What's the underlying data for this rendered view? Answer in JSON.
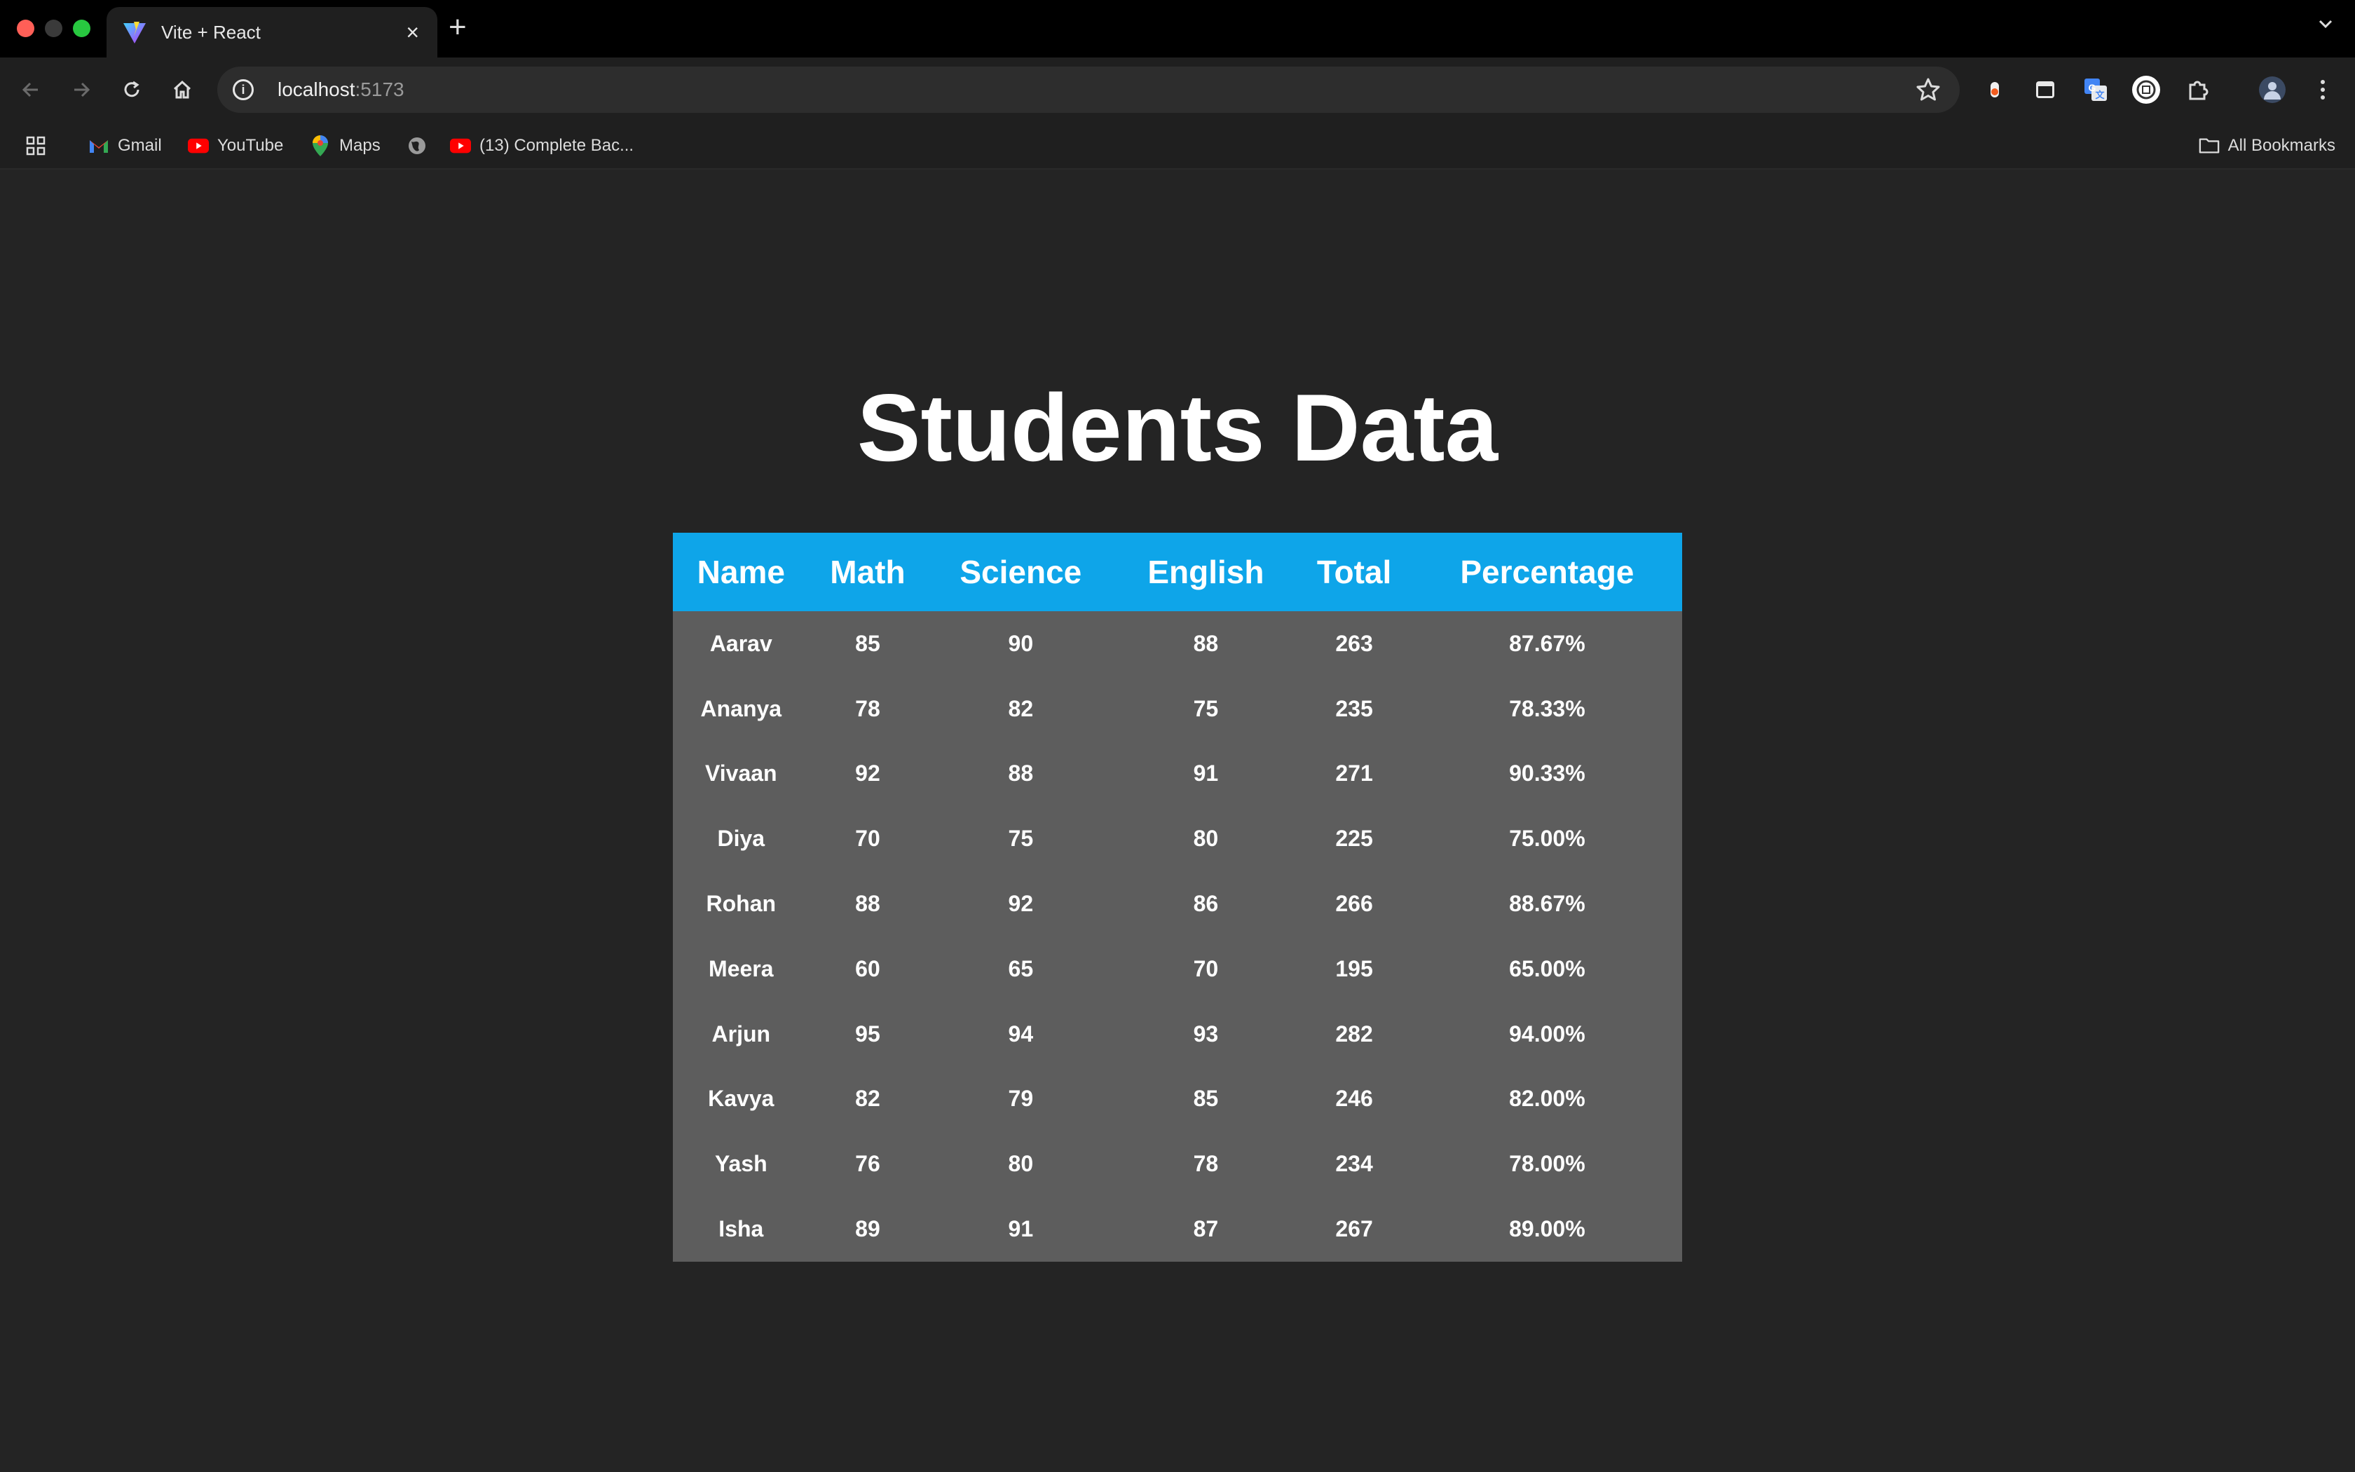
{
  "browser": {
    "tab_title": "Vite + React",
    "tab_close": "×",
    "new_tab": "+",
    "url_host": "localhost",
    "url_port": ":5173",
    "bookmarks": [
      {
        "label": "Gmail",
        "icon": "gmail-icon"
      },
      {
        "label": "YouTube",
        "icon": "youtube-icon"
      },
      {
        "label": "Maps",
        "icon": "maps-icon"
      },
      {
        "label": "",
        "icon": "globe-icon"
      },
      {
        "label": "(13) Complete Bac...",
        "icon": "youtube-icon"
      }
    ],
    "all_bookmarks": "All Bookmarks",
    "colors": {
      "tabbar": "#000000",
      "toolbar": "#1f1f1f",
      "omnibox": "#2d2d2d"
    }
  },
  "page": {
    "title": "Students Data",
    "colors": {
      "background": "#242424",
      "header": "#0ea5e9",
      "body": "#5d5d5d",
      "text": "#ffffff"
    }
  },
  "table": {
    "headers": [
      "Name",
      "Math",
      "Science",
      "English",
      "Total",
      "Percentage"
    ],
    "rows": [
      [
        "Aarav",
        "85",
        "90",
        "88",
        "263",
        "87.67%"
      ],
      [
        "Ananya",
        "78",
        "82",
        "75",
        "235",
        "78.33%"
      ],
      [
        "Vivaan",
        "92",
        "88",
        "91",
        "271",
        "90.33%"
      ],
      [
        "Diya",
        "70",
        "75",
        "80",
        "225",
        "75.00%"
      ],
      [
        "Rohan",
        "88",
        "92",
        "86",
        "266",
        "88.67%"
      ],
      [
        "Meera",
        "60",
        "65",
        "70",
        "195",
        "65.00%"
      ],
      [
        "Arjun",
        "95",
        "94",
        "93",
        "282",
        "94.00%"
      ],
      [
        "Kavya",
        "82",
        "79",
        "85",
        "246",
        "82.00%"
      ],
      [
        "Yash",
        "76",
        "80",
        "78",
        "234",
        "78.00%"
      ],
      [
        "Isha",
        "89",
        "91",
        "87",
        "267",
        "89.00%"
      ]
    ]
  }
}
